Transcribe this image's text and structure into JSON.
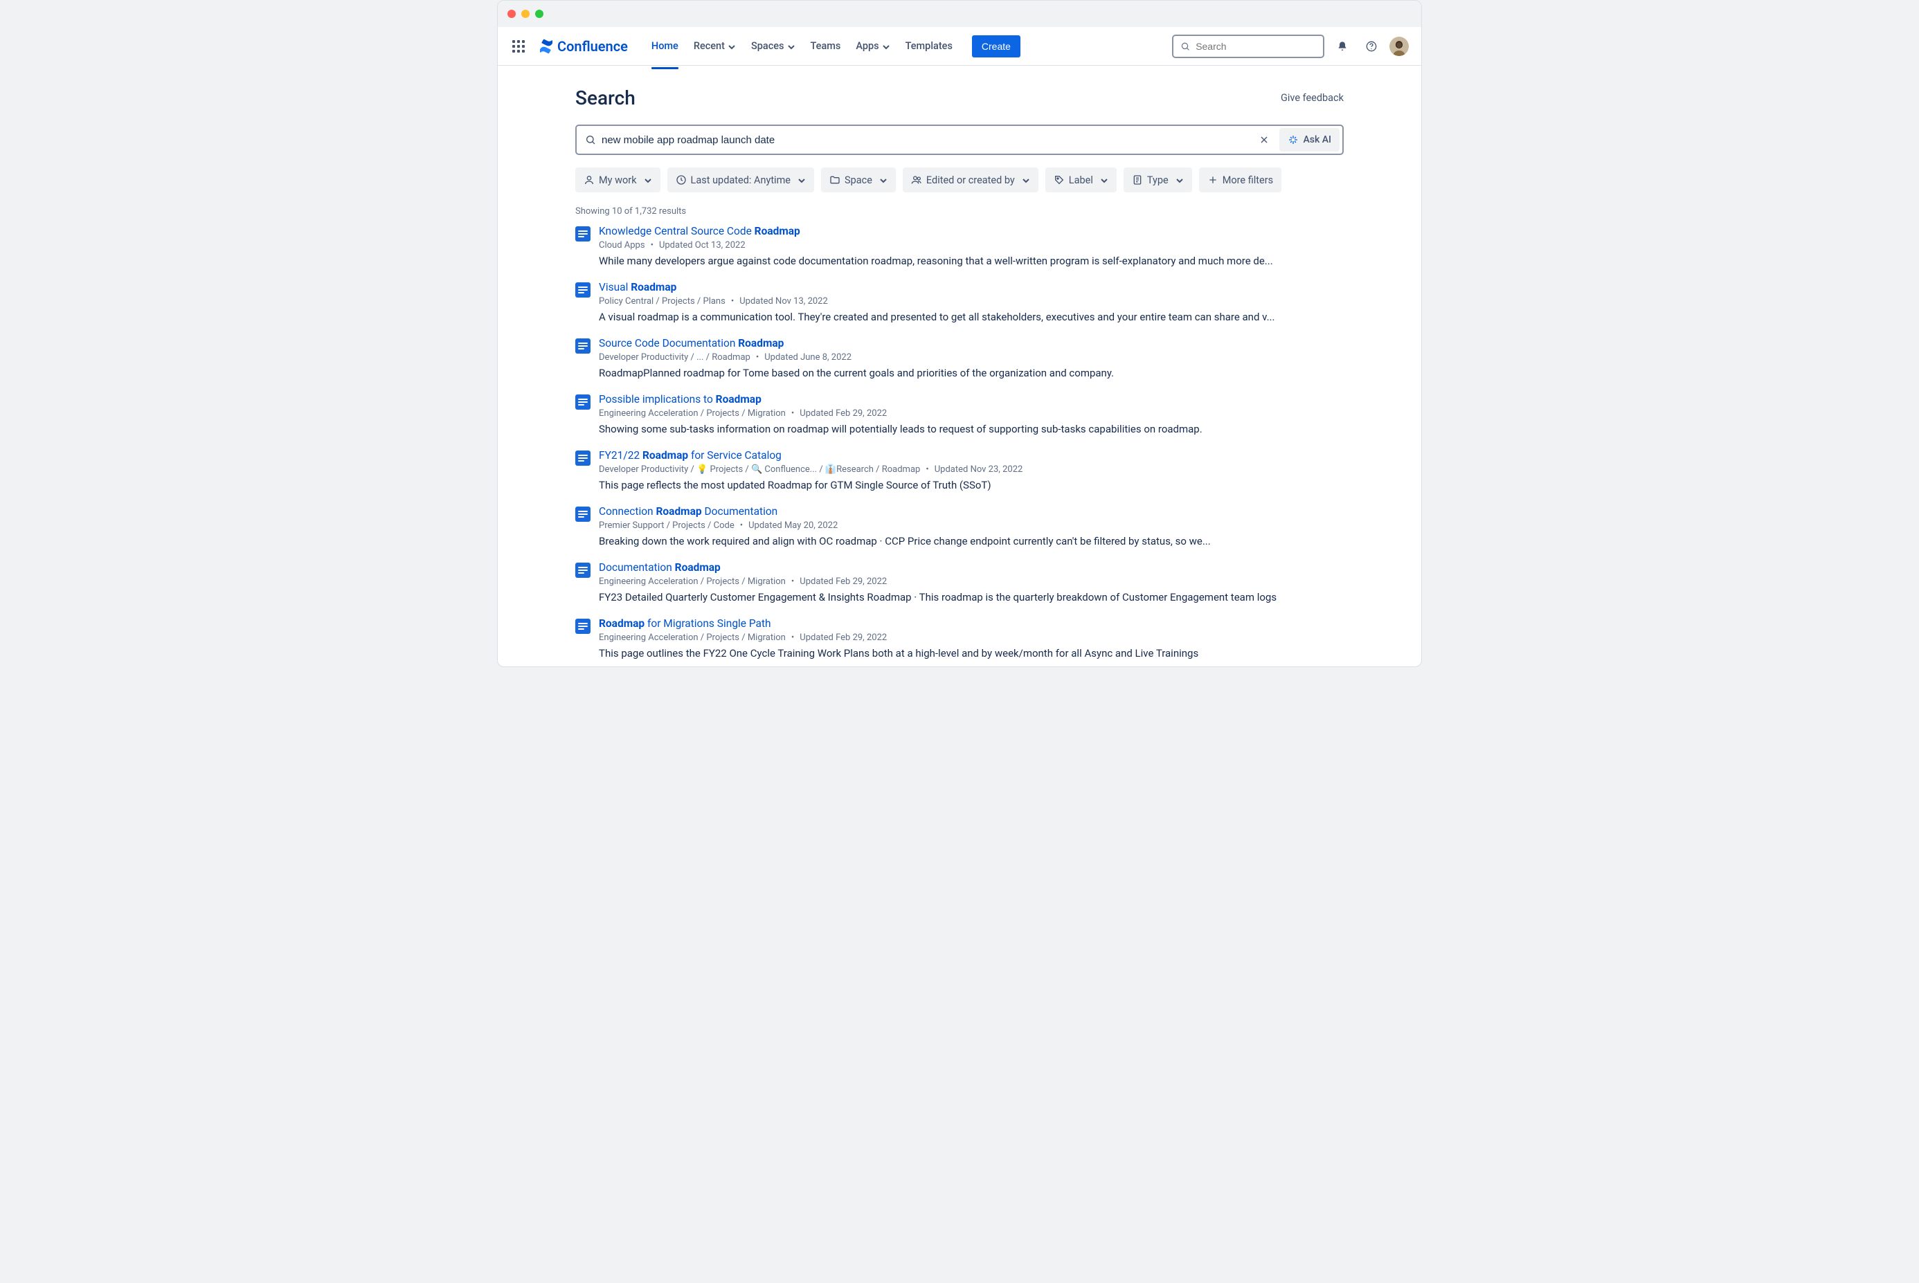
{
  "product": "Confluence",
  "nav": {
    "home": "Home",
    "recent": "Recent",
    "spaces": "Spaces",
    "teams": "Teams",
    "apps": "Apps",
    "templates": "Templates",
    "create": "Create",
    "search_placeholder": "Search"
  },
  "page": {
    "title": "Search",
    "feedback": "Give feedback",
    "query": "new mobile app roadmap launch date",
    "ask_ai": "Ask AI"
  },
  "filters": {
    "my_work": "My work",
    "last_updated": "Last updated: Anytime",
    "space": "Space",
    "edited_by": "Edited or created by",
    "label": "Label",
    "type": "Type",
    "more": "More filters"
  },
  "results_summary": "Showing 10 of 1,732 results",
  "results": [
    {
      "title_pre": "Knowledge Central Source Code ",
      "title_hl": "Roadmap",
      "title_post": "",
      "meta_path": "Cloud Apps",
      "meta_updated": "Updated Oct 13, 2022",
      "snippet": "While many developers argue against code documentation roadmap, reasoning that a well-written program is self-explanatory and much more de..."
    },
    {
      "title_pre": "Visual ",
      "title_hl": "Roadmap",
      "title_post": "",
      "meta_path": "Policy Central / Projects / Plans",
      "meta_updated": "Updated Nov 13, 2022",
      "snippet": "A visual roadmap is a communication tool. They're created and presented to get all stakeholders, executives and your entire team can share and v..."
    },
    {
      "title_pre": "Source Code Documentation ",
      "title_hl": "Roadmap",
      "title_post": "",
      "meta_path": "Developer Productivity / ... / Roadmap",
      "meta_updated": "Updated June 8, 2022",
      "snippet": "RoadmapPlanned roadmap for Tome based on the current goals and priorities of the organization and company."
    },
    {
      "title_pre": "Possible implications to ",
      "title_hl": "Roadmap",
      "title_post": "",
      "meta_path": "Engineering Acceleration / Projects / Migration",
      "meta_updated": "Updated Feb 29, 2022",
      "snippet": "Showing some sub-tasks information on roadmap will potentially leads to request of supporting sub-tasks capabilities on roadmap."
    },
    {
      "title_pre": "FY21/22 ",
      "title_hl": "Roadmap",
      "title_post": " for Service Catalog",
      "meta_path": "Developer Productivity / 💡 Projects / 🔍 Confluence... / 👔Research / Roadmap",
      "meta_updated": "Updated Nov 23, 2022",
      "snippet": "This page reflects the most updated Roadmap for GTM Single Source of Truth (SSoT)"
    },
    {
      "title_pre": "Connection ",
      "title_hl": "Roadmap",
      "title_post": " Documentation",
      "meta_path": "Premier Support / Projects / Code",
      "meta_updated": "Updated May 20, 2022",
      "snippet": "Breaking down the work required and align with OC roadmap · CCP Price change endpoint currently can't be filtered by status, so we..."
    },
    {
      "title_pre": "Documentation ",
      "title_hl": "Roadmap",
      "title_post": "",
      "meta_path": "Engineering Acceleration / Projects / Migration",
      "meta_updated": "Updated Feb 29, 2022",
      "snippet": "FY23 Detailed Quarterly Customer Engagement & Insights Roadmap · This roadmap is the quarterly breakdown of Customer Engagement team logs"
    },
    {
      "title_pre": "",
      "title_hl": "Roadmap",
      "title_post": " for Migrations Single Path",
      "meta_path": "Engineering Acceleration / Projects / Migration",
      "meta_updated": "Updated Feb 29, 2022",
      "snippet": "This page outlines the FY22 One Cycle Training Work Plans both at a high-level and by week/month for all Async and Live Trainings"
    }
  ]
}
